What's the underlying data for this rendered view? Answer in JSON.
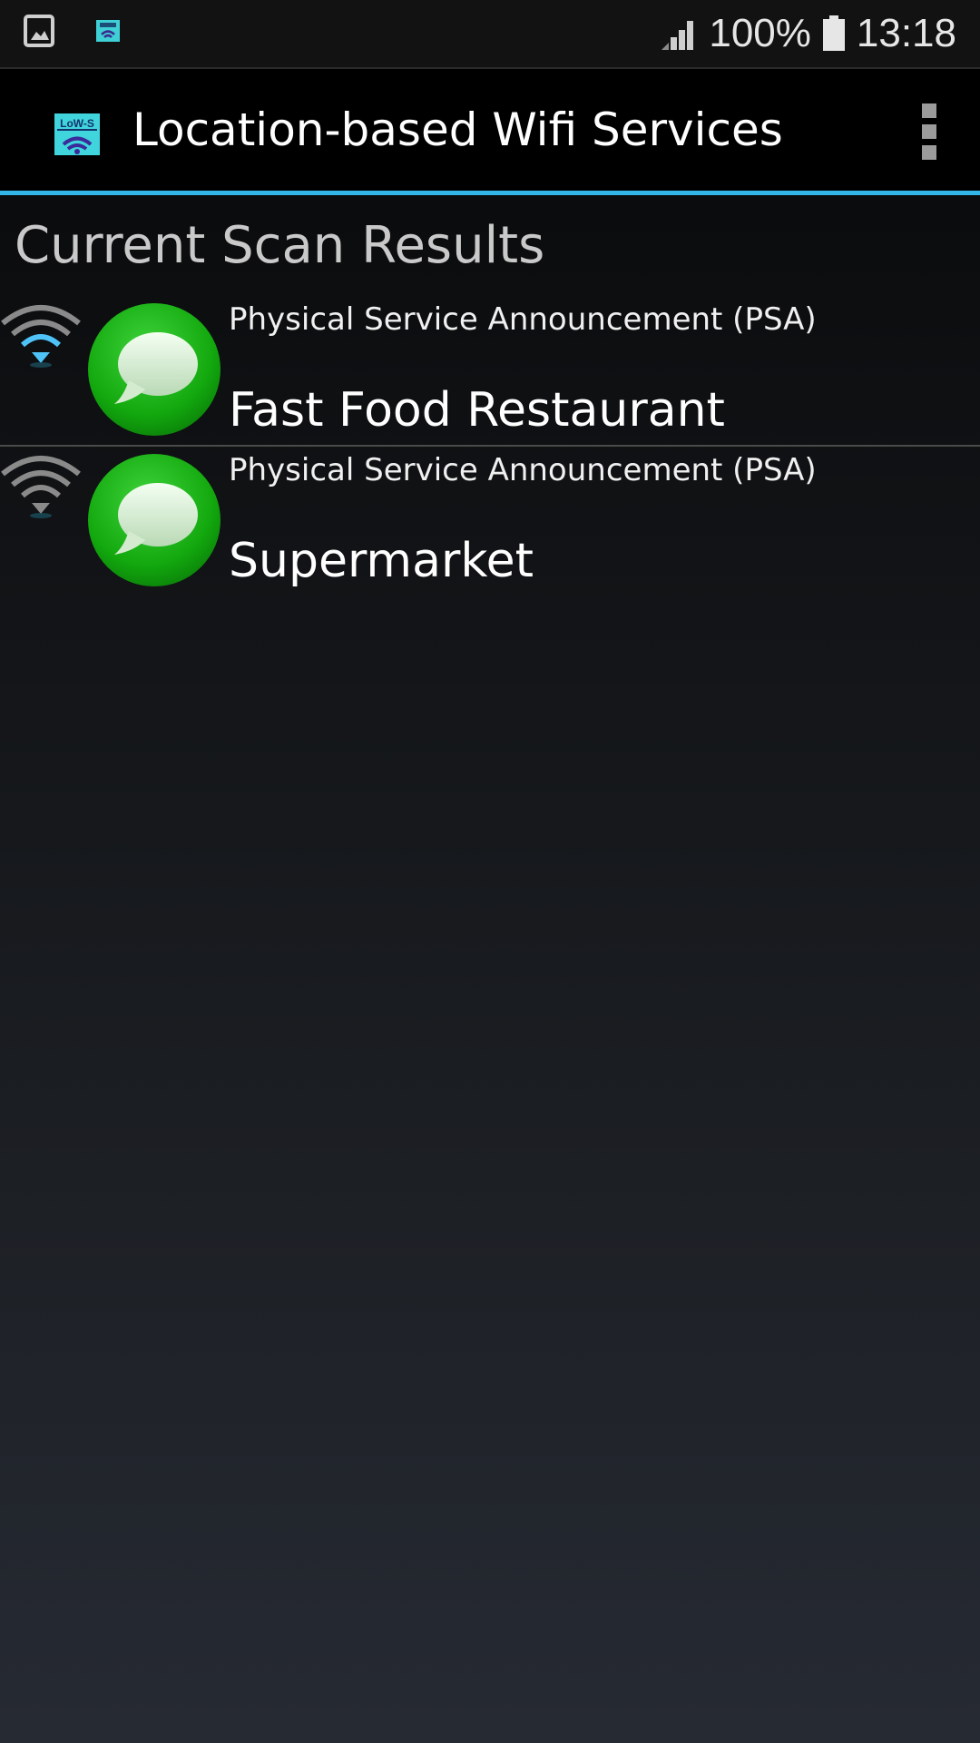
{
  "status_bar": {
    "left_icons": [
      "gallery-icon",
      "lows-app-icon"
    ],
    "signal_icon": "signal-bars-icon",
    "battery_percent": "100%",
    "battery_icon": "battery-icon",
    "time": "13:18"
  },
  "app_bar": {
    "app_icon": "lows-logo-icon",
    "app_icon_text": "LoW-S",
    "title": "Location-based Wifi Services",
    "overflow_icon": "overflow-menu-icon",
    "accent_color": "#33b5e5"
  },
  "section": {
    "title": "Current Scan Results"
  },
  "scan_results": [
    {
      "signal_icon": "wifi-signal-icon",
      "signal_color": "#4fc3f7",
      "icon": "green-chat-bubble-icon",
      "type": "Physical Service Announcement (PSA)",
      "name": "Fast Food Restaurant"
    },
    {
      "signal_icon": "wifi-signal-icon",
      "signal_color": "#8a8a8a",
      "icon": "green-chat-bubble-icon",
      "type": "Physical Service Announcement (PSA)",
      "name": "Supermarket"
    }
  ]
}
